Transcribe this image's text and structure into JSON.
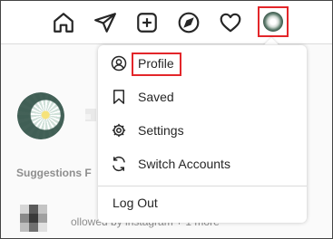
{
  "topbar": {
    "icons": [
      "home-icon",
      "direct-message-icon",
      "new-post-icon",
      "explore-icon",
      "activity-heart-icon",
      "profile-avatar"
    ]
  },
  "menu": {
    "items": [
      {
        "label": "Profile",
        "icon": "profile-icon"
      },
      {
        "label": "Saved",
        "icon": "bookmark-icon"
      },
      {
        "label": "Settings",
        "icon": "settings-gear-icon"
      },
      {
        "label": "Switch Accounts",
        "icon": "switch-accounts-icon"
      }
    ],
    "logout_label": "Log Out"
  },
  "content": {
    "suggestions_label": "Suggestions F",
    "footer_text": "ollowed by instagram + 1 more"
  },
  "colors": {
    "highlight": "#e3262a",
    "icon": "#262626",
    "muted": "#8e8e8e"
  }
}
